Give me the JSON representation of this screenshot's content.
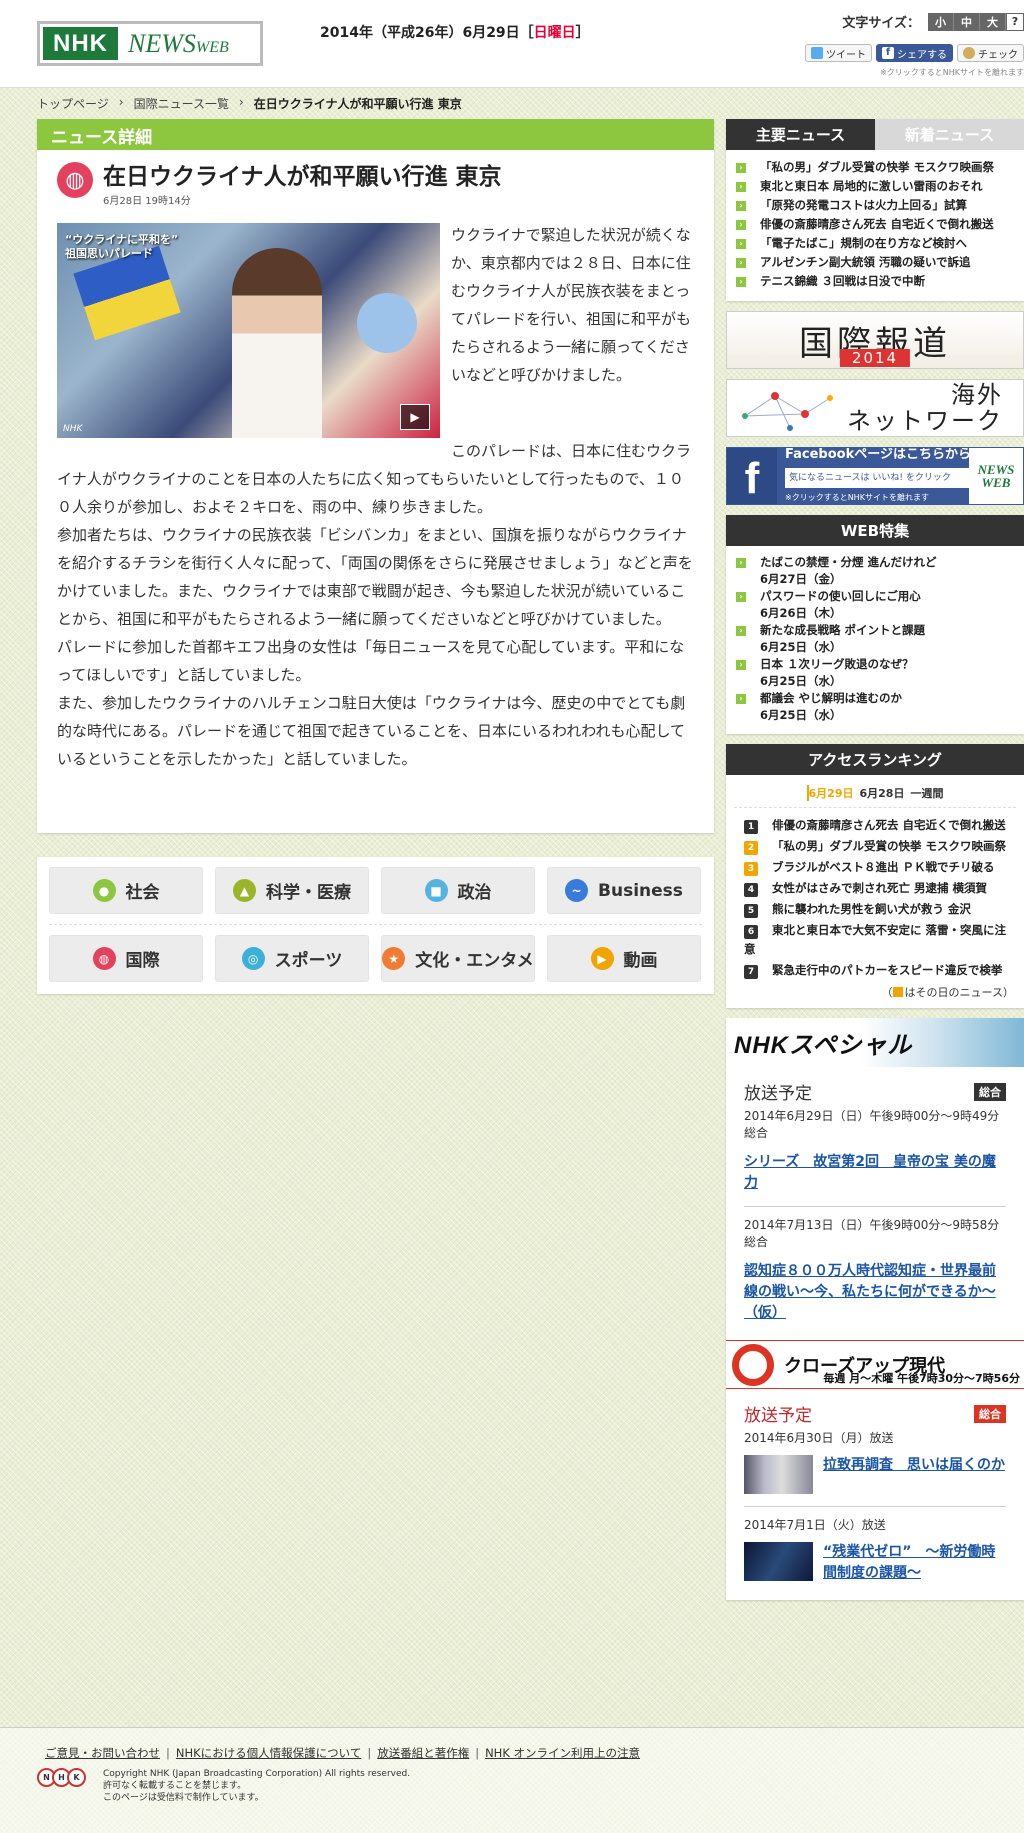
{
  "header": {
    "logo_nhk": "NHK",
    "logo_news": "NEWS",
    "logo_web": "WEB",
    "date_prefix": "2014年（平成26年）6月29日［",
    "date_dow": "日曜日",
    "date_suffix": "］",
    "fontsize_label": "文字サイズ：",
    "fontsize_small": "小",
    "fontsize_mid": "中",
    "fontsize_large": "大",
    "help": "?",
    "tweet": "ツイート",
    "share": "シェアする",
    "check": "チェック",
    "note": "※クリックするとNHKサイトを離れます"
  },
  "breadcrumb": {
    "items": [
      "トップページ",
      "国際ニュース一覧"
    ],
    "current": "在日ウクライナ人が和平願い行進 東京",
    "sep": "›"
  },
  "article": {
    "section": "ニュース詳細",
    "title": "在日ウクライナ人が和平願い行進 東京",
    "time": "6月28日 19時14分",
    "photo_caption1": "“ウクライナに平和を”",
    "photo_caption2": "祖国思いパレード",
    "p1": "ウクライナで緊迫した状況が続くなか、東京都内では２８日、日本に住むウクライナ人が民族衣装をまとってパレードを行い、祖国に和平がもたらされるよう一緒に願ってくださいなどと呼びかけました。",
    "p2": "このパレードは、日本に住むウクライナ人がウクライナのことを日本の人たちに広く知ってもらいたいとして行ったもので、１００人余りが参加し、およそ２キロを、雨の中、練り歩きました。",
    "p3": "参加者たちは、ウクライナの民族衣装「ビシバンカ」をまとい、国旗を振りながらウクライナを紹介するチラシを街行く人々に配って、「両国の関係をさらに発展させましょう」などと声をかけていました。また、ウクライナでは東部で戦闘が起き、今も緊迫した状況が続いていることから、祖国に和平がもたらされるよう一緒に願ってくださいなどと呼びかけていました。",
    "p4": "パレードに参加した首都キエフ出身の女性は「毎日ニュースを見て心配しています。平和になってほしいです」と話していました。",
    "p5": "また、参加したウクライナのハルチェンコ駐日大使は「ウクライナは今、歴史の中でとても劇的な時代にある。パレードを通じて祖国で起きていることを、日本にいるわれわれも心配しているということを示したかった」と話していました。"
  },
  "categories": [
    {
      "label": "社会",
      "color": "#8dc63f"
    },
    {
      "label": "科学・医療",
      "color": "#9ab52a"
    },
    {
      "label": "政治",
      "color": "#55b3e0"
    },
    {
      "label": "Business",
      "color": "#3a7ad8"
    },
    {
      "label": "国際",
      "color": "#e4415f"
    },
    {
      "label": "スポーツ",
      "color": "#3cb0d6"
    },
    {
      "label": "文化・エンタメ",
      "color": "#f07b32"
    },
    {
      "label": "動画",
      "color": "#f0a500"
    }
  ],
  "sidebar": {
    "tab_main": "主要ニュース",
    "tab_new": "新着ニュース",
    "main_news": [
      "「私の男」ダブル受賞の快挙 モスクワ映画祭",
      "東北と東日本 局地的に激しい雷雨のおそれ",
      "「原発の発電コストは火力上回る」試算",
      "俳優の斎藤晴彦さん死去 自宅近くで倒れ搬送",
      "「電子たばこ」規制の在り方など検討へ",
      "アルゼンチン副大統領 汚職の疑いで訴追",
      "テニス錦織 ３回戦は日没で中断"
    ],
    "kokusai_title": "国際報道",
    "kokusai_year": "2014",
    "kaigai_title1": "海外",
    "kaigai_title2": "ネットワーク",
    "fb_title": "Facebookページはこちらから",
    "fb_sub": "気になるニュースは いいね! をクリック",
    "fb_note": "※クリックするとNHKサイトを離れます",
    "fb_logo": "NEWS WEB",
    "web_head": "WEB特集",
    "web_items": [
      {
        "title": "たばこの禁煙・分煙 進んだけれど",
        "date": "6月27日（金）"
      },
      {
        "title": "パスワードの使い回しにご用心",
        "date": "6月26日（木）"
      },
      {
        "title": "新たな成長戦略 ポイントと課題",
        "date": "6月25日（水）"
      },
      {
        "title": "日本 １次リーグ敗退のなぜ？",
        "date": "6月25日（水）"
      },
      {
        "title": "都議会 やじ解明は進むのか",
        "date": "6月25日（水）"
      }
    ],
    "rank_head": "アクセスランキング",
    "rank_tabs": [
      "6月29日",
      "6月28日",
      "一週間"
    ],
    "ranking": [
      {
        "n": "1",
        "t": "俳優の斎藤晴彦さん死去 自宅近くで倒れ搬送",
        "today": false
      },
      {
        "n": "2",
        "t": "「私の男」ダブル受賞の快挙 モスクワ映画祭",
        "today": true
      },
      {
        "n": "3",
        "t": "ブラジルがベスト８進出 ＰＫ戦でチリ破る",
        "today": true
      },
      {
        "n": "4",
        "t": "女性がはさみで刺され死亡 男逮捕 横須賀",
        "today": false
      },
      {
        "n": "5",
        "t": "熊に襲われた男性を飼い犬が救う 金沢",
        "today": false
      },
      {
        "n": "6",
        "t": "東北と東日本で大気不安定に 落雷・突風に注意",
        "today": false
      },
      {
        "n": "7",
        "t": "緊急走行中のパトカーをスピード違反で検挙",
        "today": false
      }
    ],
    "rank_note_pre": "（",
    "rank_note": "はその日のニュース）",
    "special_logo": "NHKスペシャル",
    "special_sched": "放送予定",
    "special_tag": "総合",
    "special_items": [
      {
        "air": "2014年6月29日（日）午後9時00分～9時49分総合",
        "title": "シリーズ　故宮第2回　皇帝の宝 美の魔力"
      },
      {
        "air": "2014年7月13日（日）午後9時00分～9時58分総合",
        "title": "認知症８００万人時代認知症・世界最前線の戦い～今、私たちに何ができるか～（仮）"
      }
    ],
    "closeup_name": "クローズアップ現代",
    "closeup_sched_time": "毎週 月～木曜 午後7時30分～7時56分",
    "closeup_sched": "放送予定",
    "closeup_tag": "総合",
    "closeup_items": [
      {
        "air": "2014年6月30日（月）放送",
        "title": "拉致再調査　思いは届くのか"
      },
      {
        "air": "2014年7月1日（火）放送",
        "title": "“残業代ゼロ”　～新労働時間制度の課題～"
      }
    ]
  },
  "footer": {
    "links": [
      "ご意見・お問い合わせ",
      "NHKにおける個人情報保護について",
      "放送番組と著作権",
      "NHK オンライン利用上の注意"
    ],
    "copy1": "Copyright NHK (Japan Broadcasting Corporation) All rights reserved.",
    "copy2": "許可なく転載することを禁じます。",
    "copy3": "このページは受信料で制作しています。"
  }
}
